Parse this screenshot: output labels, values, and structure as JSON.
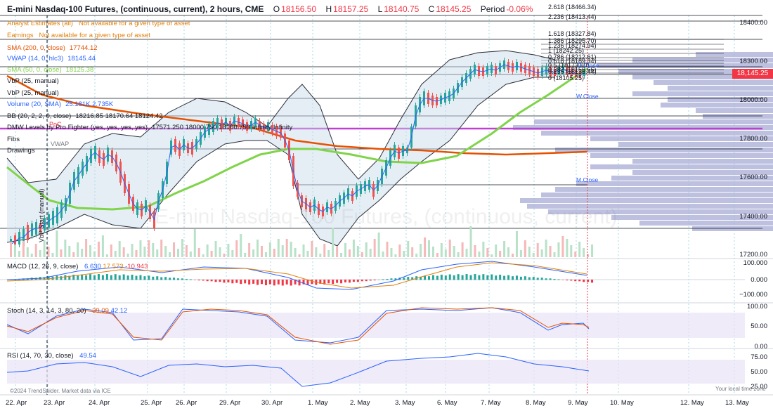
{
  "header": {
    "title": "E-mini Nasdaq-100 Futures, (continuous, current), 2 hours, CME",
    "o_label": "O",
    "o": "18156.50",
    "h_label": "H",
    "h": "18157.25",
    "l_label": "L",
    "l": "18140.75",
    "c_label": "C",
    "c": "18145.25",
    "period_label": "Period",
    "period": "-0.06%"
  },
  "indicators": [
    {
      "name": "Analyst Estimates (all)",
      "value": "Not available for a given type of asset",
      "color": "#e0820c"
    },
    {
      "name": "Earnings",
      "value": "Not available for a given type of asset",
      "color": "#e0820c"
    },
    {
      "name": "SMA (200, 0, close)",
      "value": "17744.12",
      "color": "#e65100"
    },
    {
      "name": "VWAP (14, 0, hlc3)",
      "value": "18145.44",
      "color": "#2962ff"
    },
    {
      "name": "SMA (50, 0, close)",
      "value": "18125.38",
      "color": "#7fd44a"
    },
    {
      "name": "VbP (25, manual)",
      "value": "",
      "color": "#131722"
    },
    {
      "name": "VbP (25, manual)",
      "value": "",
      "color": "#131722"
    },
    {
      "name": "Volume (20, SMA)",
      "value": "25.181K 2.735K",
      "color": "#2962ff"
    },
    {
      "name": "BB (20, 2, 2, 0, close)",
      "value": "18216.85 18170.64 18124.42",
      "color": "#131722"
    },
    {
      "name": "DMW Levels by Pro Fighter (yes, yes, yes, yes)",
      "value": "17571.250 18000.750 18160.750 Infinity Infinity",
      "color": "#131722"
    },
    {
      "name": "Fibs",
      "value": "",
      "color": "#131722"
    },
    {
      "name": "Drawings",
      "value": "",
      "color": "#131722"
    }
  ],
  "price_axis": [
    "18400.00",
    "18300.00",
    "18000.00",
    "17800.00",
    "17600.00",
    "17400.00",
    "17200.00"
  ],
  "last_price": "18,145.25",
  "macd": {
    "label": "MACD (12, 26, 9, close)",
    "v1": "6.630",
    "v2": "17.573",
    "v3": "-10.943",
    "axis": [
      "100.000",
      "0.000",
      "−100.000"
    ]
  },
  "stoch": {
    "label": "Stoch (14, 3, 14, 3, 80, 20)",
    "v1": "39.09",
    "v2": "42.12",
    "axis": [
      "100.00",
      "50.00",
      "0.00"
    ]
  },
  "rsi": {
    "label": "RSI (14, 70, 30, close)",
    "v1": "49.54",
    "axis": [
      "75.00",
      "50.00",
      "25.00"
    ]
  },
  "dates": [
    "22. Apr",
    "23. Apr",
    "24. Apr",
    "25. Apr",
    "26. Apr",
    "29. Apr",
    "30. Apr",
    "1. May",
    "2. May",
    "3. May",
    "6. May",
    "7. May",
    "8. May",
    "9. May",
    "10. May",
    "12. May",
    "13. May"
  ],
  "fibs": [
    "2.618 (18466.34)",
    "2.236 (18413.44)",
    "1.618 (18327.84)",
    "1.386 (18295.70)",
    "1.236 (18274.94)",
    "1 (18242.25)",
    "0.786 (18212.61)",
    "0.618 (18189.34)",
    "0.5 (18173.00)",
    "0.382 (18156.66)",
    "0.236 (18136.44)",
    "0 (18105.25)"
  ],
  "level_labels": {
    "d_close": "D.Close",
    "w_close": "W.Close",
    "m_close": "M.Close",
    "poc": "PoC",
    "vwap": "VWAP",
    "vwap_start": "VbP Start (manual)"
  },
  "watermark": "E-mini Nasdaq-100 Futures, (continuous, current)",
  "footer": {
    "left": "©2024 TrendSpider. Market data via ICE",
    "right": "Your local time zone"
  }
}
